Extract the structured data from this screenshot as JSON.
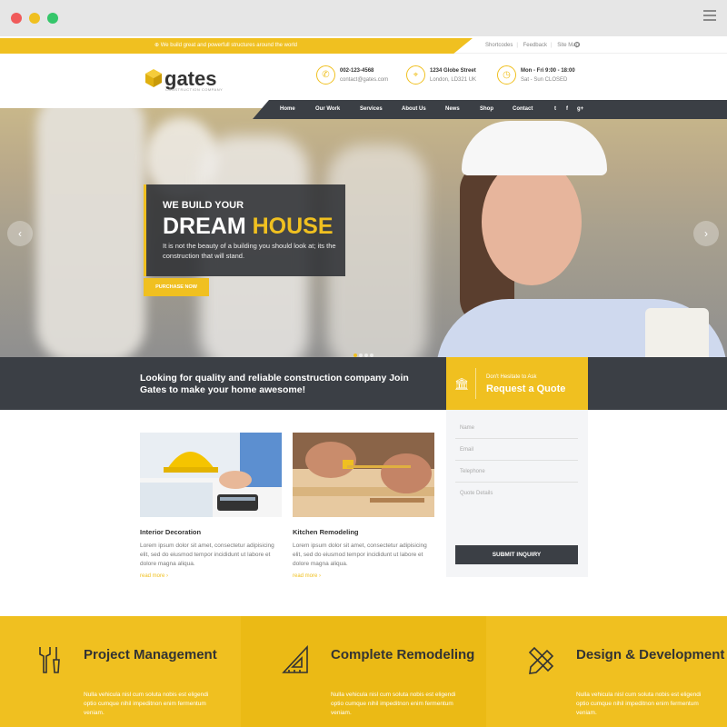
{
  "topbar": {
    "message": "⊕ We build great and powerfull structures around the world",
    "links": [
      "Shortcodes",
      "Feedback",
      "Site Map"
    ]
  },
  "logo": {
    "name": "gates",
    "tagline": "CONSTRUCTION COMPANY"
  },
  "header_info": [
    {
      "icon": "phone-icon",
      "line1": "002-123-4568",
      "line2": "contact@gates.com"
    },
    {
      "icon": "map-pin-icon",
      "line1": "1234 Globe Street",
      "line2": "London, LD321 UK"
    },
    {
      "icon": "clock-icon",
      "line1": "Mon - Fri 9:00 - 18:00",
      "line2": "Sat - Sun CLOSED"
    }
  ],
  "nav": {
    "items": [
      "Home",
      "Our Work",
      "Services",
      "About Us",
      "News",
      "Shop",
      "Contact"
    ],
    "social": [
      "twitter-icon",
      "facebook-icon",
      "google-plus-icon"
    ]
  },
  "hero": {
    "kicker": "WE BUILD YOUR",
    "headline_a": "DREAM",
    "headline_b": "HOUSE",
    "text": "It is not the beauty of a building you should look at; its the construction that will stand.",
    "button": "PURCHASE NOW",
    "slides": 4,
    "active_slide": 1
  },
  "cta": {
    "text": "Looking for quality and reliable construction company Join Gates to make your home awesome!",
    "quote_small": "Don't Hesitate to Ask",
    "quote_big": "Request a Quote"
  },
  "form": {
    "fields": [
      "Name",
      "Email",
      "Telephone",
      "Quote Details"
    ],
    "submit": "SUBMIT INQUIRY"
  },
  "cards": [
    {
      "title": "Interior Decoration",
      "body": "Lorem ipsum dolor sit amet, consectetur adipisicing elit, sed do eiusmod tempor incididunt ut labore et dolore magna aliqua.",
      "more": "read more ›"
    },
    {
      "title": "Kitchen Remodeling",
      "body": "Lorem ipsum dolor sit amet, consectetur adipisicing elit, sed do eiusmod tempor incididunt ut labore et dolore magna aliqua.",
      "more": "read more ›"
    }
  ],
  "features": [
    {
      "icon": "tools-icon",
      "title": "Project Management",
      "body": "Nulla vehicula nisl cum soluta nobis est eligendi optio cumque nihil impeditnon enim fermentum veniam.",
      "color": "#f0c020"
    },
    {
      "icon": "ruler-triangle-icon",
      "title": "Complete Remodeling",
      "body": "Nulla vehicula nisl cum soluta nobis est eligendi optio cumque nihil impeditnon enim fermentum veniam.",
      "color": "#ebba15"
    },
    {
      "icon": "pencil-ruler-icon",
      "title": "Design & Development",
      "body": "Nulla vehicula nisl cum soluta nobis est eligendi optio cumque nihil impeditnon enim fermentum veniam.",
      "color": "#f0c020"
    }
  ],
  "colors": {
    "accent": "#f0c020",
    "dark": "#3b3f45"
  }
}
